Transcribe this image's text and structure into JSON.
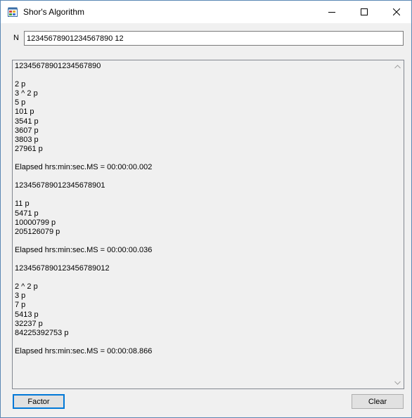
{
  "window": {
    "title": "Shor's Algorithm"
  },
  "form": {
    "n_label": "N",
    "n_value": "12345678901234567890 12"
  },
  "output": {
    "lines": [
      "12345678901234567890",
      "",
      "2 p",
      "3 ^ 2 p",
      "5 p",
      "101 p",
      "3541 p",
      "3607 p",
      "3803 p",
      "27961 p",
      "",
      "Elapsed hrs:min:sec.MS = 00:00:00.002",
      "",
      "123456789012345678901",
      "",
      "11 p",
      "5471 p",
      "10000799 p",
      "205126079 p",
      "",
      "Elapsed hrs:min:sec.MS = 00:00:00.036",
      "",
      "1234567890123456789012",
      "",
      "2 ^ 2 p",
      "3 p",
      "7 p",
      "5413 p",
      "32237 p",
      "84225392753 p",
      "",
      "Elapsed hrs:min:sec.MS = 00:00:08.866"
    ]
  },
  "buttons": {
    "factor": "Factor",
    "clear": "Clear"
  },
  "colors": {
    "accent": "#0078d7",
    "window_bg": "#f0f0f0"
  },
  "icons": {
    "app": "app-window-icon",
    "minimize": "minimize-icon",
    "maximize": "maximize-icon",
    "close": "close-icon",
    "scroll_up": "chevron-up-icon",
    "scroll_down": "chevron-down-icon"
  }
}
